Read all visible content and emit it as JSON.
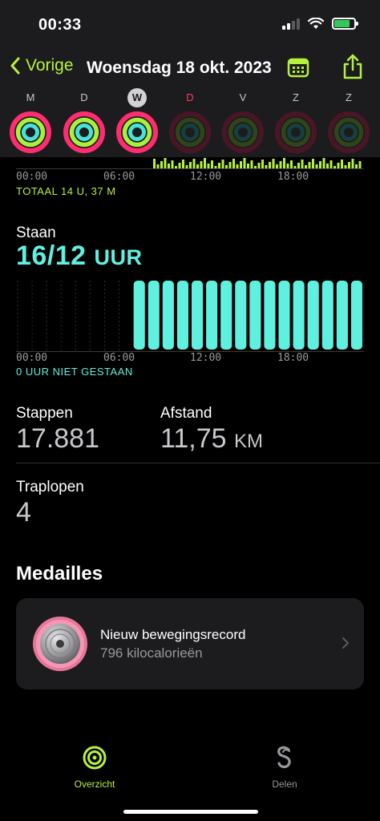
{
  "status": {
    "time": "00:33"
  },
  "nav": {
    "back_label": "Vorige",
    "title": "Woensdag 18 okt. 2023"
  },
  "week": [
    {
      "letter": "M",
      "active": true,
      "highlight": false
    },
    {
      "letter": "D",
      "active": true,
      "highlight": false
    },
    {
      "letter": "W",
      "active": true,
      "highlight": true
    },
    {
      "letter": "D",
      "active": false,
      "highlight": false,
      "red": true
    },
    {
      "letter": "V",
      "active": false,
      "highlight": false
    },
    {
      "letter": "Z",
      "active": false,
      "highlight": false
    },
    {
      "letter": "Z",
      "active": false,
      "highlight": false
    }
  ],
  "move_chart": {
    "ticks": [
      "00:00",
      "06:00",
      "12:00",
      "18:00"
    ],
    "total": "TOTAAL 14 U, 37 M",
    "color": "#b6f23c"
  },
  "stand": {
    "label": "Staan",
    "value": "16/12",
    "unit": "UUR",
    "ticks": [
      "00:00",
      "06:00",
      "12:00",
      "18:00"
    ],
    "note": "0 UUR NIET GESTAAN",
    "color": "#5ff0e0"
  },
  "stats": {
    "steps_label": "Stappen",
    "steps_value": "17.881",
    "distance_label": "Afstand",
    "distance_value": "11,75",
    "distance_unit": "KM",
    "stairs_label": "Traplopen",
    "stairs_value": "4"
  },
  "medals": {
    "heading": "Medailles",
    "title": "Nieuw bewegingsrecord",
    "subtitle": "796 kilocalorieën"
  },
  "tabs": [
    {
      "label": "Overzicht",
      "active": true
    },
    {
      "label": "Delen",
      "active": false
    }
  ]
}
